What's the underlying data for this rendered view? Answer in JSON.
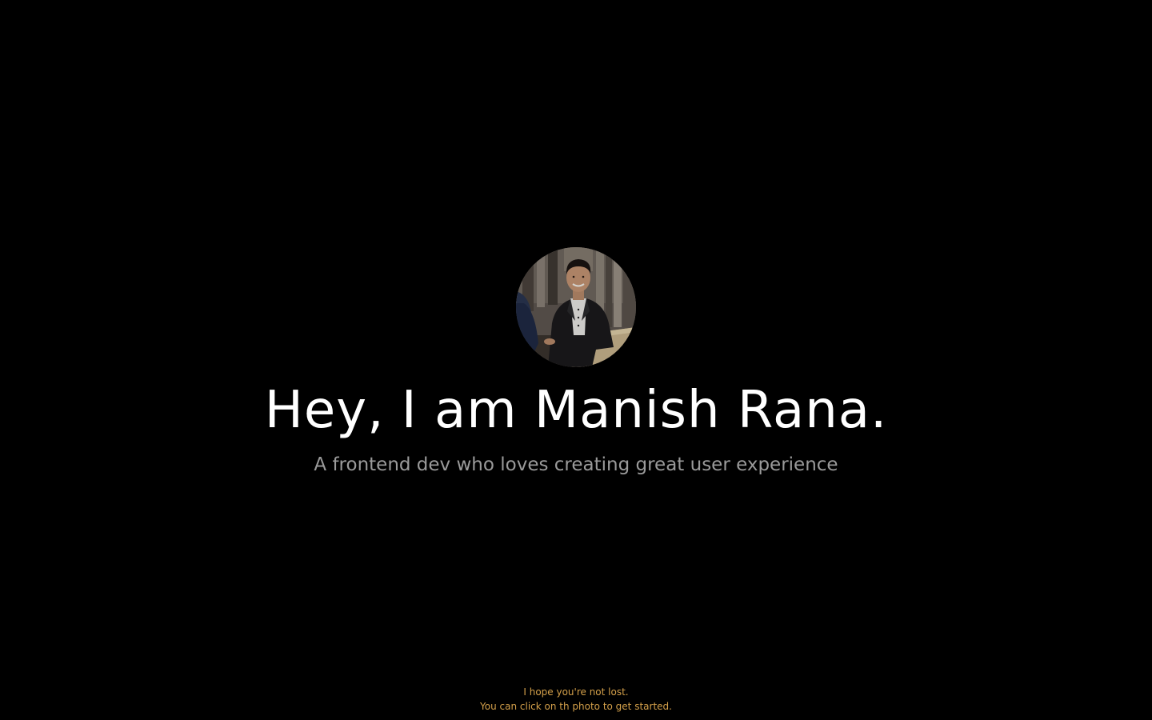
{
  "hero": {
    "avatar_alt": "photo",
    "headline": "Hey, I am Manish Rana.",
    "tagline": "A frontend dev who loves creating great user experience"
  },
  "hint": {
    "line1": "I hope you're not lost.",
    "line2": "You can click on th photo to get started."
  },
  "colors": {
    "background": "#000000",
    "headline": "#ffffff",
    "tagline": "#9a9a9a",
    "hint": "#d4a04a"
  }
}
